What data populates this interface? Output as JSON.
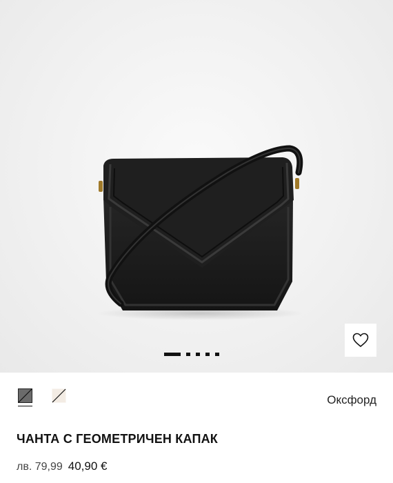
{
  "product": {
    "title": "ЧАНТА С ГЕОМЕТРИЧЕН КАПАК",
    "old_price": "лв. 79,99",
    "new_price": "40,90 €",
    "color_name": "Оксфорд",
    "image_alt": "black-crossbody-bag"
  },
  "gallery": {
    "slides": 5,
    "active_index": 0
  },
  "swatches": [
    {
      "name": "black",
      "color": "#1a1a1a",
      "selected": true
    },
    {
      "name": "beige",
      "color": "#f3ece4",
      "selected": false
    }
  ],
  "colors": {
    "accent": "#111111",
    "background": "#ffffff"
  },
  "icons": {
    "wishlist": "heart-icon"
  }
}
